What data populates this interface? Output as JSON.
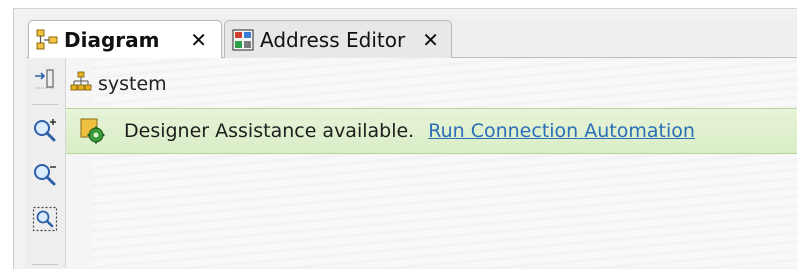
{
  "tabs": [
    {
      "label": "Diagram",
      "icon": "diagram-icon",
      "active": true
    },
    {
      "label": "Address Editor",
      "icon": "address-editor-icon",
      "active": false
    }
  ],
  "close_glyph": "✕",
  "breadcrumb": {
    "label": "system",
    "icon": "hierarchy-icon"
  },
  "banner": {
    "message": "Designer Assistance available.",
    "link": "Run Connection Automation",
    "icon": "gear-block-icon",
    "color": "#dcefca"
  },
  "toolbar": {
    "items": [
      {
        "name": "expand-icon"
      },
      {
        "name": "zoom-in-icon"
      },
      {
        "name": "zoom-out-icon"
      },
      {
        "name": "zoom-fit-icon"
      }
    ]
  },
  "colors": {
    "link": "#2a6fb8",
    "banner_bg": "#dcefca",
    "banner_border": "#b6d79a"
  }
}
